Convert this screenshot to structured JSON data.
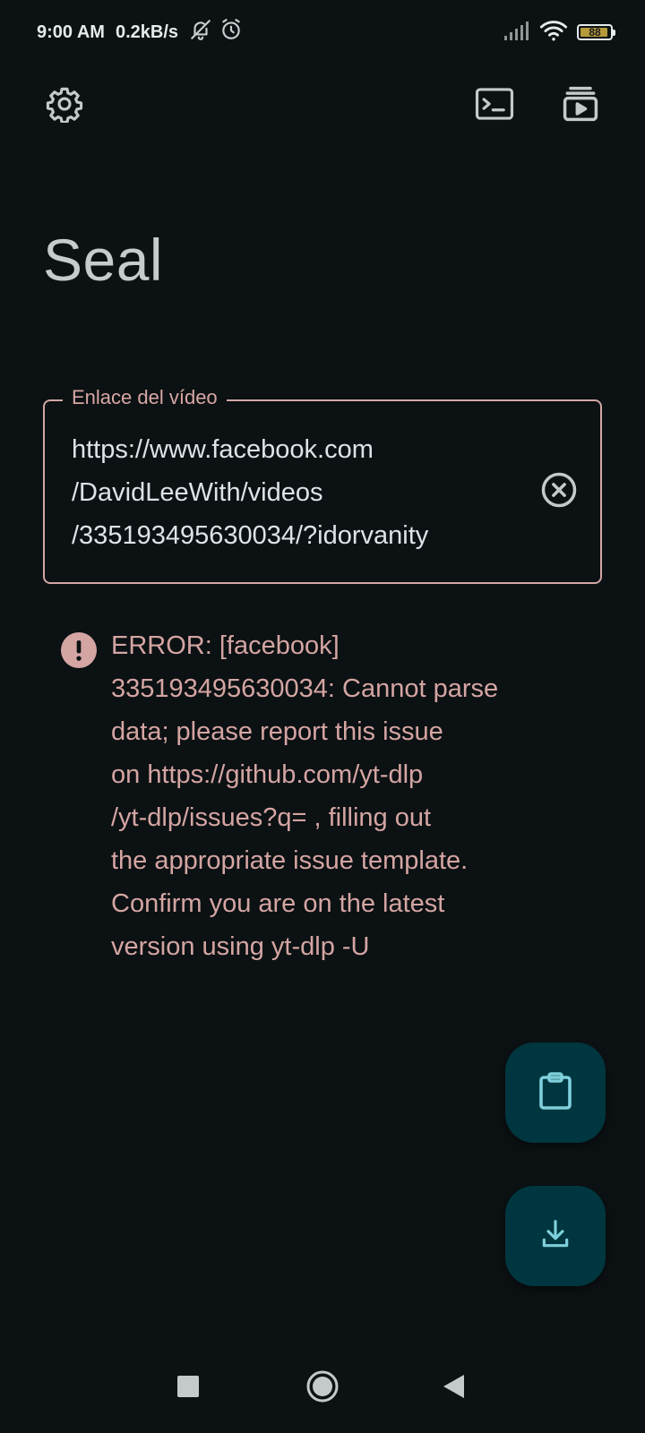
{
  "status_bar": {
    "time": "9:00 AM",
    "net_speed": "0.2kB/s",
    "battery_level": "88",
    "icons": [
      "notifications-off-icon",
      "alarm-icon",
      "signal-icon",
      "wifi-icon",
      "battery-icon"
    ]
  },
  "top_bar": {
    "icons": [
      "settings-icon",
      "terminal-icon",
      "video-library-icon"
    ]
  },
  "app": {
    "title": "Seal"
  },
  "url_field": {
    "label": "Enlace del vídeo",
    "value": "https://www.facebook.com\n/DavidLeeWith/videos\n/335193495630034/?idorvanity"
  },
  "error": {
    "message": "ERROR: [facebook]\n335193495630034: Cannot parse\ndata; please report this issue\non  https://github.com/yt-dlp\n/yt-dlp/issues?q= , filling out\nthe appropriate issue template.\nConfirm you are on the latest\nversion using  yt-dlp -U"
  },
  "fabs": {
    "icons": [
      "clipboard-icon",
      "download-icon"
    ]
  },
  "nav_bar": {
    "icons": [
      "recents-icon",
      "home-icon",
      "back-icon"
    ]
  },
  "colors": {
    "background": "#0c1113",
    "accent_error": "#d4a5a3",
    "fab": "#00363f",
    "fab_icon": "#7fd0dc"
  }
}
